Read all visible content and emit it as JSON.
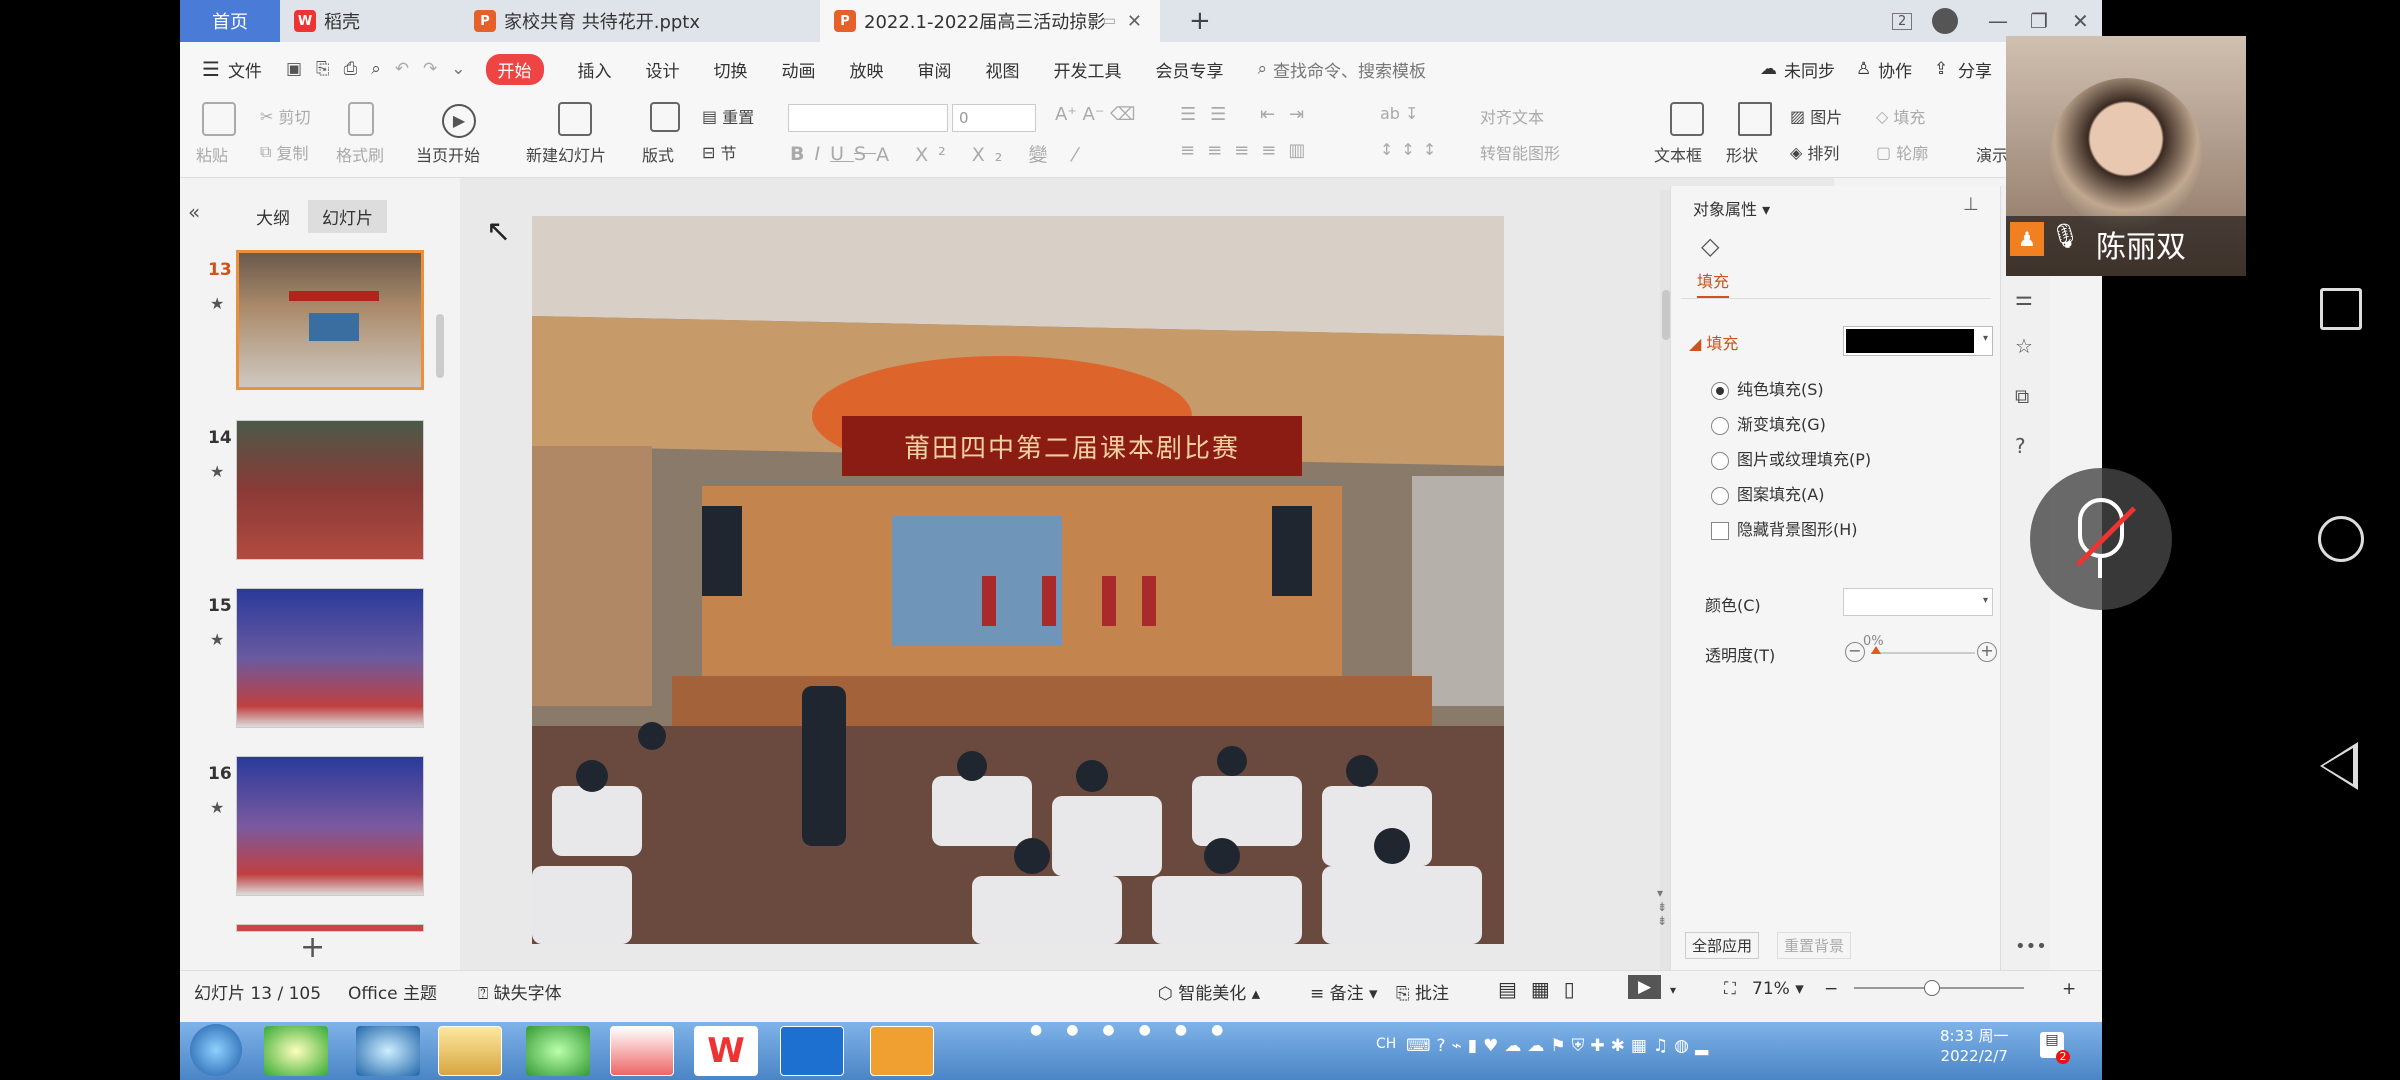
{
  "tabs": {
    "home": "首页",
    "wps": "稻壳",
    "doc1": "家校共育 共待花开.pptx",
    "doc2": "2022.1-2022届高三活动掠影",
    "badge": "2"
  },
  "menu": {
    "file": "文件",
    "items": [
      "开始",
      "插入",
      "设计",
      "切换",
      "动画",
      "放映",
      "审阅",
      "视图",
      "开发工具",
      "会员专享"
    ],
    "search": "查找命令、搜索模板",
    "sync": "未同步",
    "collab": "协作",
    "share": "分享"
  },
  "ribbon": {
    "paste": "粘贴",
    "cut": "剪切",
    "copy": "复制",
    "format_painter": "格式刷",
    "from_current": "当页开始",
    "new_slide": "新建幻灯片",
    "layout": "版式",
    "section": "节",
    "reset": "重置",
    "font_size": "0",
    "align_text": "对齐文本",
    "smartart": "转智能图形",
    "textbox": "文本框",
    "shape": "形状",
    "picture": "图片",
    "arrange": "排列",
    "fill": "填充",
    "outline": "轮廓",
    "present": "演示"
  },
  "left_panel": {
    "outline_tab": "大纲",
    "slides_tab": "幻灯片",
    "thumbs": [
      {
        "num": "13",
        "selected": true
      },
      {
        "num": "14",
        "selected": false
      },
      {
        "num": "15",
        "selected": false
      },
      {
        "num": "16",
        "selected": false
      }
    ],
    "add": "+"
  },
  "slide": {
    "banner": "莆田四中第二届课本剧比赛"
  },
  "right_panel": {
    "title": "对象属性",
    "fill_tab": "填充",
    "fill_section": "填充",
    "options": [
      {
        "label": "纯色填充(S)",
        "checked": true
      },
      {
        "label": "渐变填充(G)",
        "checked": false
      },
      {
        "label": "图片或纹理填充(P)",
        "checked": false
      },
      {
        "label": "图案填充(A)",
        "checked": false
      }
    ],
    "hide_bg": "隐藏背景图形(H)",
    "color_label": "颜色(C)",
    "transparency_label": "透明度(T)",
    "transparency_value": "0%",
    "apply_all": "全部应用",
    "reset_bg": "重置背景",
    "fill_color": "#000000"
  },
  "status": {
    "slide_count": "幻灯片 13 / 105",
    "theme": "Office 主题",
    "missing_font": "缺失字体",
    "beautify": "智能美化",
    "notes": "备注",
    "comment": "批注",
    "zoom": "71%"
  },
  "taskbar": {
    "time": "8:33 周一",
    "date": "2022/2/7",
    "ch": "CH",
    "notif": "2"
  },
  "overlay": {
    "name": "陈丽双"
  }
}
